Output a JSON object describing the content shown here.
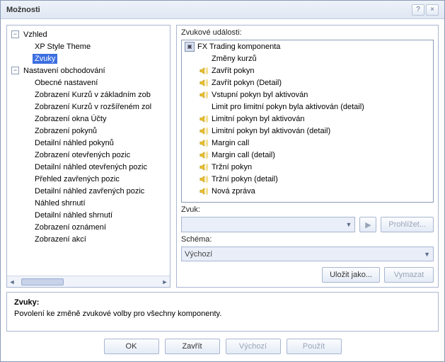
{
  "window": {
    "title": "Možnosti"
  },
  "tree": {
    "root1": {
      "label": "Vzhled",
      "expanded": true
    },
    "root1_children": [
      {
        "label": "XP Style Theme",
        "selected": false
      },
      {
        "label": "Zvuky",
        "selected": true
      }
    ],
    "root2": {
      "label": "Nastavení obchodování",
      "expanded": true
    },
    "root2_children": [
      {
        "label": "Obecné nastavení"
      },
      {
        "label": "Zobrazení Kurzů v základním zob"
      },
      {
        "label": "Zobrazení Kurzů v rozšířeném zol"
      },
      {
        "label": "Zobrazení okna Účty"
      },
      {
        "label": "Zobrazení pokynů"
      },
      {
        "label": "Detailní náhled pokynů"
      },
      {
        "label": "Zobrazení otevřených pozic"
      },
      {
        "label": "Detailní náhled otevřených pozic"
      },
      {
        "label": "Přehled zavřených pozic"
      },
      {
        "label": "Detailní náhled zavřených pozic"
      },
      {
        "label": "Náhled shrnutí"
      },
      {
        "label": "Detailní náhled shrnutí"
      },
      {
        "label": "Zobrazení oznámení"
      },
      {
        "label": "Zobrazení akcí"
      }
    ]
  },
  "events": {
    "label": "Zvukové události:",
    "items": [
      {
        "icon": "app",
        "label": "FX Trading komponenta"
      },
      {
        "icon": "none",
        "label": "Změny kurzů"
      },
      {
        "icon": "speaker",
        "label": "Zavřít pokyn"
      },
      {
        "icon": "speaker",
        "label": "Zavřít pokyn (Detail)"
      },
      {
        "icon": "speaker",
        "label": "Vstupní pokyn byl aktivován"
      },
      {
        "icon": "none",
        "label": "Limit pro limitní pokyn byla aktivován (detail)"
      },
      {
        "icon": "speaker",
        "label": "Limitní pokyn byl aktivován"
      },
      {
        "icon": "speaker",
        "label": "Limitní pokyn byl aktivován (detail)"
      },
      {
        "icon": "speaker",
        "label": "Margin call"
      },
      {
        "icon": "speaker",
        "label": "Margin call (detail)"
      },
      {
        "icon": "speaker",
        "label": "Tržní pokyn"
      },
      {
        "icon": "speaker",
        "label": "Tržní pokyn (detail)"
      },
      {
        "icon": "speaker",
        "label": "Nová zpráva"
      }
    ]
  },
  "sound": {
    "label": "Zvuk:",
    "value": ""
  },
  "scheme": {
    "label": "Schéma:",
    "value": "Výchozí"
  },
  "buttons": {
    "browse": "Prohlížet...",
    "play": "▶",
    "saveas": "Uložit jako...",
    "delete": "Vymazat",
    "ok": "OK",
    "close": "Zavřít",
    "default": "Výchozí",
    "apply": "Použít"
  },
  "description": {
    "title": "Zvuky:",
    "text": "Povolení ke změně zvukové volby pro všechny komponenty."
  }
}
